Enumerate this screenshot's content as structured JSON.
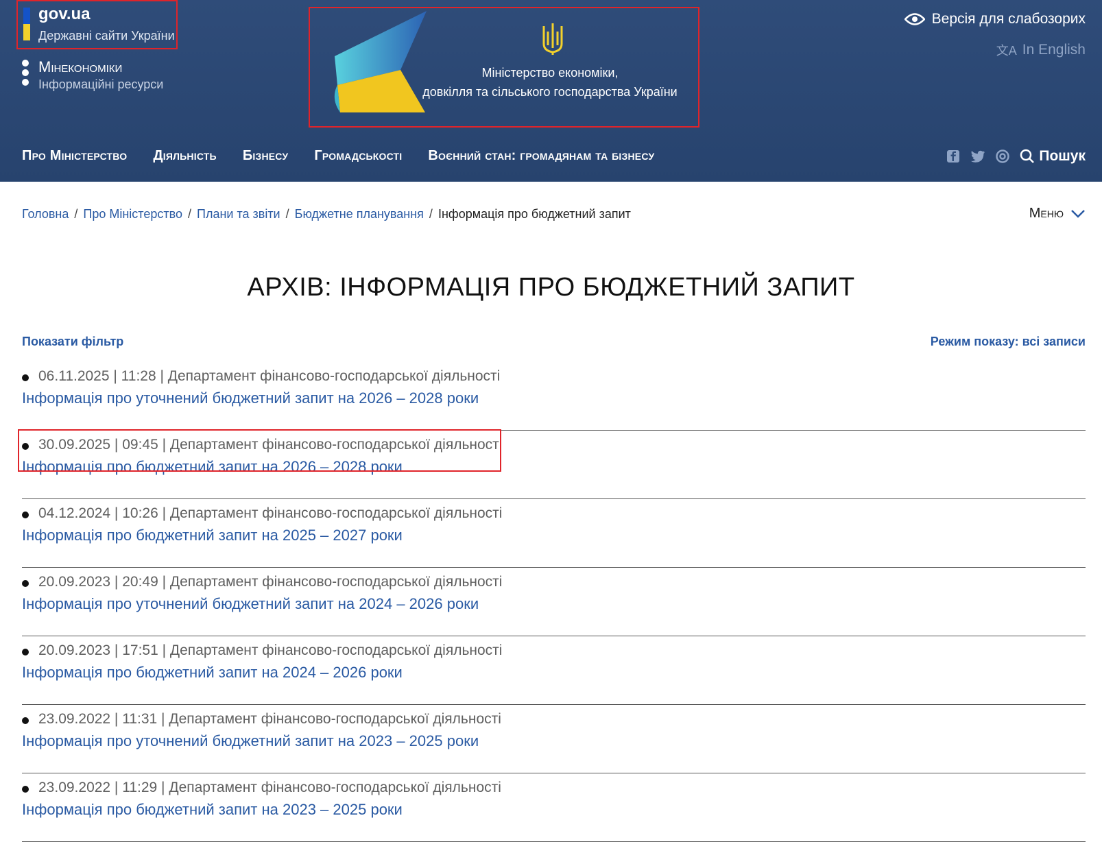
{
  "header": {
    "gov_title": "gov.ua",
    "gov_subtitle": "Державні сайти України",
    "site_title": "Мінекономіки",
    "site_subtitle": "Інформаційні ресурси",
    "ministry_line1": "Міністерство економіки,",
    "ministry_line2": "довкілля та сільського господарства України",
    "low_vision_label": "Версія для слабозорих",
    "lang_label": "In English",
    "search_label": "Пошук",
    "colors": {
      "bg": "#2f4c79",
      "flag_blue": "#1453c8",
      "flag_yellow": "#f3d12c",
      "link": "#2a5aa3",
      "highlight": "#e0242a"
    }
  },
  "nav": [
    {
      "label": "Про Міністерство"
    },
    {
      "label": "Діяльність"
    },
    {
      "label": "Бізнесу"
    },
    {
      "label": "Громадськості"
    },
    {
      "label": "Воєнний стан: громадянам та бізнесу"
    }
  ],
  "social": [
    "facebook-icon",
    "twitter-icon",
    "instagram-icon"
  ],
  "breadcrumb": {
    "items": [
      "Головна",
      "Про Міністерство",
      "Плани та звіти",
      "Бюджетне планування"
    ],
    "current": "Інформація про бюджетний запит",
    "separator": "/"
  },
  "menu_label": "Меню",
  "page_title": "АРХІВ: ІНФОРМАЦІЯ ПРО БЮДЖЕТНИЙ ЗАПИТ",
  "filter_label": "Показати фільтр",
  "mode_label": "Режим показу: всі записи",
  "records": [
    {
      "meta": "06.11.2025 | 11:28 | Департамент фінансово-господарської діяльності",
      "title": "Інформація про уточнений бюджетний запит на 2026 – 2028 роки",
      "highlighted": false
    },
    {
      "meta": "30.09.2025 | 09:45 | Департамент фінансово-господарської діяльності",
      "title": "Інформація про бюджетний запит на 2026 – 2028 роки",
      "highlighted": true
    },
    {
      "meta": "04.12.2024 | 10:26 | Департамент фінансово-господарської діяльності",
      "title": "Інформація про бюджетний запит на 2025 – 2027 роки",
      "highlighted": false
    },
    {
      "meta": "20.09.2023 | 20:49 | Департамент фінансово-господарської діяльності",
      "title": "Інформація про уточнений бюджетний запит на 2024 – 2026 роки",
      "highlighted": false
    },
    {
      "meta": "20.09.2023 | 17:51 | Департамент фінансово-господарської діяльності",
      "title": "Інформація про бюджетний запит на 2024 – 2026 роки",
      "highlighted": false
    },
    {
      "meta": "23.09.2022 | 11:31 | Департамент фінансово-господарської діяльності",
      "title": "Інформація про уточнений бюджетний запит на 2023 – 2025 роки",
      "highlighted": false
    },
    {
      "meta": "23.09.2022 | 11:29 | Департамент фінансово-господарської діяльності",
      "title": "Інформація про бюджетний запит на 2023 – 2025 роки",
      "highlighted": false
    }
  ]
}
